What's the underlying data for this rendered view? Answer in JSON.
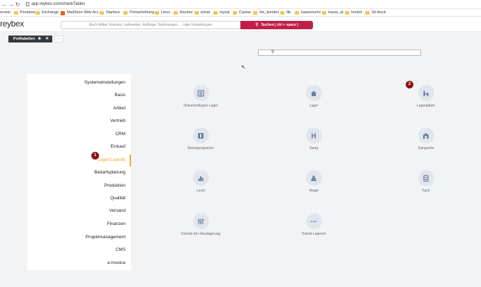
{
  "browser": {
    "url": "app.reybex.com/checkTables",
    "bookmarks": [
      "ernein",
      "Pentatos",
      "Exchange",
      "MailStore Web Acc...",
      "Starface",
      "Preiserhöhung",
      "Linux",
      "Reybex",
      "privat",
      "mysql",
      "Canias",
      "rbx_kunden",
      "ttb",
      "kassenschv",
      "kasse_at",
      "fondof",
      "3d druck"
    ]
  },
  "header": {
    "logo": "reybex",
    "search_placeholder": "Nach Artikel, Kunden, Lieferanten, Aufträge, Rechnungen, ... oder Einstellungen",
    "search_button": "Suchen ( ctrl + space )"
  },
  "tabs": {
    "active_tab": "Prüftabellen",
    "more": "..."
  },
  "menu": {
    "items": [
      "Systemeinstellungen",
      "Basis",
      "Artikel",
      "Vertrieb",
      "CRM",
      "Einkauf",
      "Lager/Logistik",
      "Bedarfsplanung",
      "Produktion",
      "Qualität",
      "Versand",
      "Finanzen",
      "Projektmanagement",
      "CMS",
      "e-Invoice"
    ],
    "active_index": 6
  },
  "badges": {
    "menu_badge": "1",
    "tile_badge": "2"
  },
  "tiles": [
    {
      "label": "Dokumenttypen Lager",
      "icon": "document-icon"
    },
    {
      "label": "Lager",
      "icon": "home-icon"
    },
    {
      "label": "Lagerplätze",
      "icon": "shelf-icon"
    },
    {
      "label": "Bewegungsarten",
      "icon": "movement-icon"
    },
    {
      "label": "Gang",
      "icon": "aisle-icon"
    },
    {
      "label": "Gangseite",
      "icon": "warehouse-icon"
    },
    {
      "label": "Level",
      "icon": "bar-chart-icon"
    },
    {
      "label": "Regal",
      "icon": "road-icon"
    },
    {
      "label": "Fach",
      "icon": "drawer-icon"
    },
    {
      "label": "Gründe Ein-/Auslagerung",
      "icon": "sliders-icon"
    },
    {
      "label": "Transit Lagerort",
      "icon": "dots-icon"
    }
  ],
  "colors": {
    "brand": "#c11f48",
    "active": "#f0a830",
    "badge": "#8b1111",
    "tile_bg": "#e1e6ee",
    "icon": "#6b7f98"
  }
}
